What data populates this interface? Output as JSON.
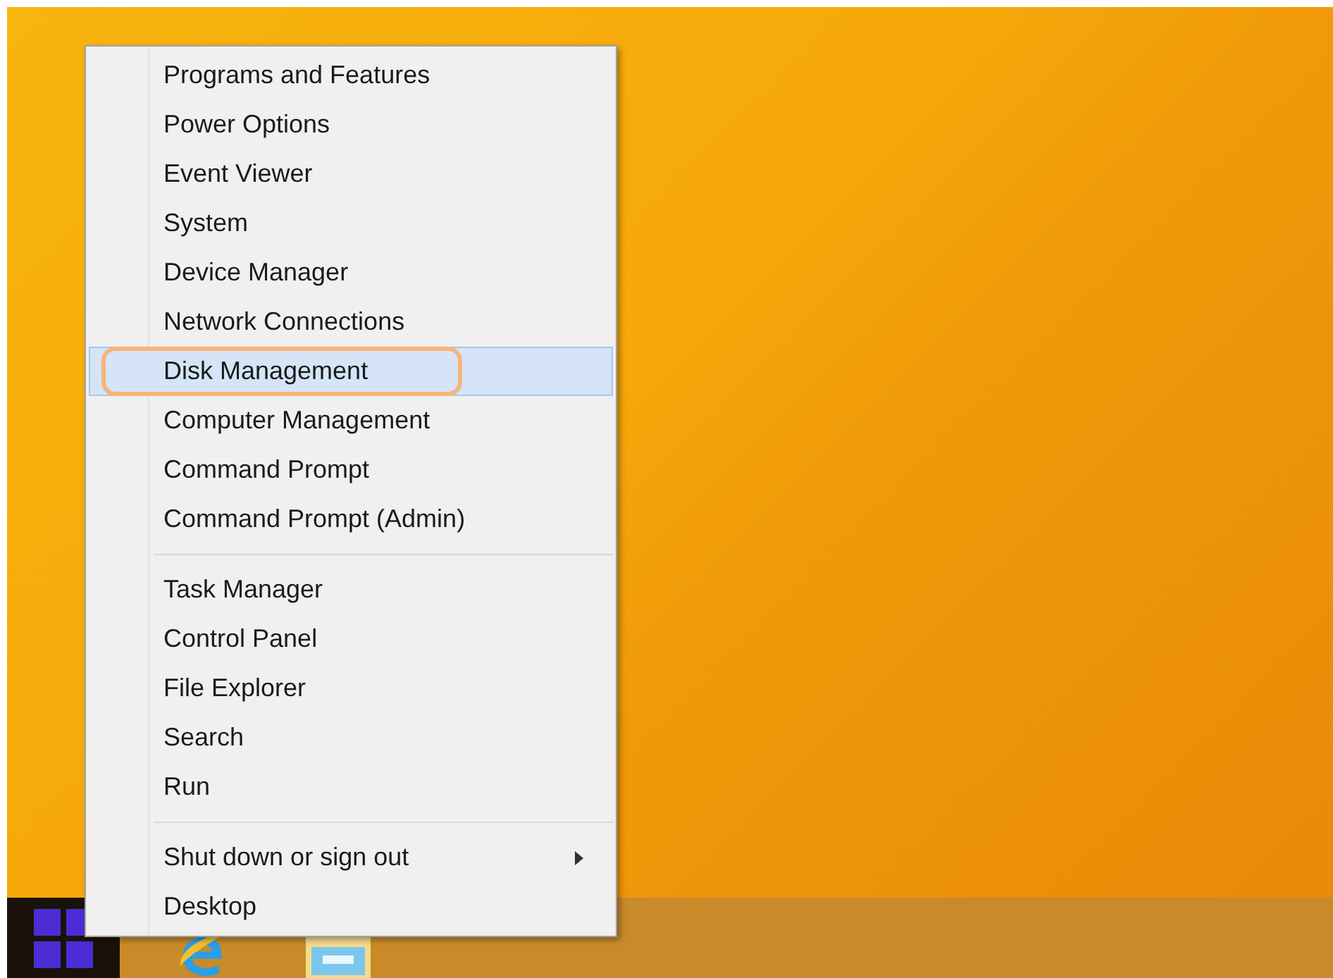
{
  "context_menu": {
    "groups": [
      {
        "items": [
          {
            "label": "Programs and Features",
            "selected": false,
            "annotated": false,
            "submenu": false
          },
          {
            "label": "Power Options",
            "selected": false,
            "annotated": false,
            "submenu": false
          },
          {
            "label": "Event Viewer",
            "selected": false,
            "annotated": false,
            "submenu": false
          },
          {
            "label": "System",
            "selected": false,
            "annotated": false,
            "submenu": false
          },
          {
            "label": "Device Manager",
            "selected": false,
            "annotated": false,
            "submenu": false
          },
          {
            "label": "Network Connections",
            "selected": false,
            "annotated": false,
            "submenu": false
          },
          {
            "label": "Disk Management",
            "selected": true,
            "annotated": true,
            "submenu": false
          },
          {
            "label": "Computer Management",
            "selected": false,
            "annotated": false,
            "submenu": false
          },
          {
            "label": "Command Prompt",
            "selected": false,
            "annotated": false,
            "submenu": false
          },
          {
            "label": "Command Prompt (Admin)",
            "selected": false,
            "annotated": false,
            "submenu": false
          }
        ]
      },
      {
        "items": [
          {
            "label": "Task Manager",
            "selected": false,
            "annotated": false,
            "submenu": false
          },
          {
            "label": "Control Panel",
            "selected": false,
            "annotated": false,
            "submenu": false
          },
          {
            "label": "File Explorer",
            "selected": false,
            "annotated": false,
            "submenu": false
          },
          {
            "label": "Search",
            "selected": false,
            "annotated": false,
            "submenu": false
          },
          {
            "label": "Run",
            "selected": false,
            "annotated": false,
            "submenu": false
          }
        ]
      },
      {
        "items": [
          {
            "label": "Shut down or sign out",
            "selected": false,
            "annotated": false,
            "submenu": true
          },
          {
            "label": "Desktop",
            "selected": false,
            "annotated": false,
            "submenu": false
          }
        ]
      }
    ]
  }
}
